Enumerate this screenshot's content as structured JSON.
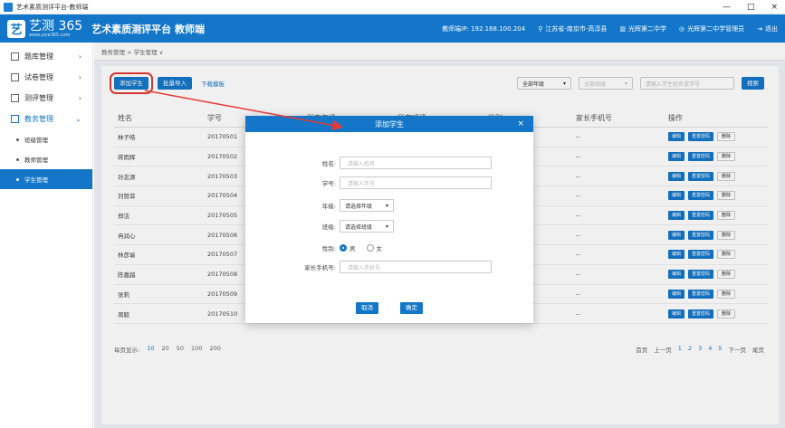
{
  "window": {
    "title": "艺术素质测评平台-教师端",
    "controls": [
      "—",
      "□",
      "×"
    ]
  },
  "header": {
    "logo_mark": "艺",
    "logo_name": "艺测 365",
    "logo_url": "www.yice365.com",
    "platform_title": "艺术素质测评平台 教师端",
    "ip_label": "教师端IP: 192.168.100.204",
    "location": "江苏省-南京市-高淳县",
    "school": "光辉第二中学",
    "admin": "光辉第二中学管理员",
    "exit": "退出"
  },
  "sidebar": {
    "items": [
      {
        "label": "题库管理",
        "chev": "›"
      },
      {
        "label": "试卷管理",
        "chev": "›"
      },
      {
        "label": "测评管理",
        "chev": "›"
      },
      {
        "label": "教务管理",
        "chev": "⌄"
      }
    ],
    "sub_items": [
      {
        "label": "班级管理"
      },
      {
        "label": "教师管理"
      },
      {
        "label": "学生管理"
      }
    ]
  },
  "breadcrumb": "教务管理 > 学生管理 ∨",
  "toolbar": {
    "add_student": "添加学生",
    "batch_import": "批量导入",
    "download_template": "下载模板"
  },
  "filters": {
    "grade": "全部年级",
    "class": "全部班级",
    "search_placeholder": "请输入学生姓名或学号",
    "search_button": "搜索"
  },
  "table": {
    "headers": [
      "姓名",
      "学号",
      "所在年级",
      "所在班级",
      "性别",
      "家长手机号",
      "操作"
    ],
    "rows": [
      {
        "name": "林子皓",
        "id": "20170501",
        "phone": "--"
      },
      {
        "name": "蒋雨辉",
        "id": "20170502",
        "phone": "--"
      },
      {
        "name": "孙志源",
        "id": "20170503",
        "phone": "--"
      },
      {
        "name": "刘赞菲",
        "id": "20170504",
        "phone": "--"
      },
      {
        "name": "郑洁",
        "id": "20170505",
        "phone": "--"
      },
      {
        "name": "冉润心",
        "id": "20170506",
        "phone": "--"
      },
      {
        "name": "林彦瑜",
        "id": "20170507",
        "phone": "--"
      },
      {
        "name": "陈嘉越",
        "id": "20170508",
        "phone": "--"
      },
      {
        "name": "张莉",
        "id": "20170509",
        "phone": "--"
      },
      {
        "name": "周毅",
        "id": "20170510",
        "phone": "--"
      }
    ],
    "ops": {
      "edit": "编辑",
      "reset_password": "重置密码",
      "delete": "删除"
    }
  },
  "pagination": {
    "per_page_label": "每页显示:",
    "per_page_options": [
      "10",
      "20",
      "50",
      "100",
      "200"
    ],
    "first": "首页",
    "prev": "上一页",
    "pages": [
      "1",
      "2",
      "3",
      "4",
      "5"
    ],
    "next": "下一页",
    "last": "尾页"
  },
  "modal": {
    "title": "添加学生",
    "close": "×",
    "name_label": "姓名:",
    "name_placeholder": "请输入姓名",
    "id_label": "学号:",
    "id_placeholder": "请输入学号",
    "grade_label": "年级:",
    "grade_select": "请选择年级",
    "class_label": "班级:",
    "class_select": "请选择班级",
    "gender_label": "性别:",
    "gender_options": [
      "男",
      "女"
    ],
    "phone_label": "家长手机号:",
    "phone_placeholder": "请输入手机号",
    "cancel": "取消",
    "confirm": "确定"
  },
  "watermark": {
    "text": "安下载",
    "url": "anxz.com"
  },
  "colors": {
    "primary": "#1376c9",
    "highlight": "#e53935"
  }
}
